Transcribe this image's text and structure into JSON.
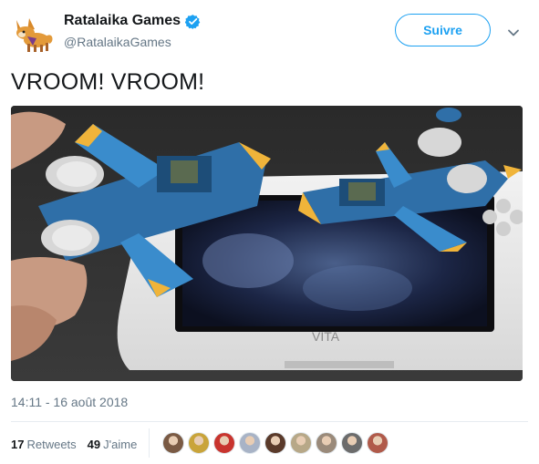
{
  "tweet": {
    "display_name": "Ratalaika Games",
    "handle": "@RatalaikaGames",
    "follow_label": "Suivre",
    "text": "VROOM! VROOM!",
    "timestamp": "14:11 - 16 août 2018",
    "retweets_count": "17",
    "retweets_label": "Retweets",
    "likes_count": "49",
    "likes_label": "J'aime",
    "console_label": "VITA"
  },
  "icons": {
    "verified": "verified-badge-icon",
    "menu": "chevron-down-icon",
    "avatar": "fox-logo-avatar"
  },
  "colors": {
    "accent": "#1da1f2",
    "text": "#14171a",
    "muted": "#657786",
    "border": "#e6ecf0"
  },
  "likers": [
    {
      "name": "liker-avatar-1",
      "color": "#7a5a44"
    },
    {
      "name": "liker-avatar-2",
      "color": "#c9a43a"
    },
    {
      "name": "liker-avatar-3",
      "color": "#c8342e"
    },
    {
      "name": "liker-avatar-4",
      "color": "#a8b3c6"
    },
    {
      "name": "liker-avatar-5",
      "color": "#5a3a2a"
    },
    {
      "name": "liker-avatar-6",
      "color": "#b7a888"
    },
    {
      "name": "liker-avatar-7",
      "color": "#9a8a7a"
    },
    {
      "name": "liker-avatar-8",
      "color": "#6c6c6c"
    },
    {
      "name": "liker-avatar-9",
      "color": "#b05a4a"
    }
  ]
}
